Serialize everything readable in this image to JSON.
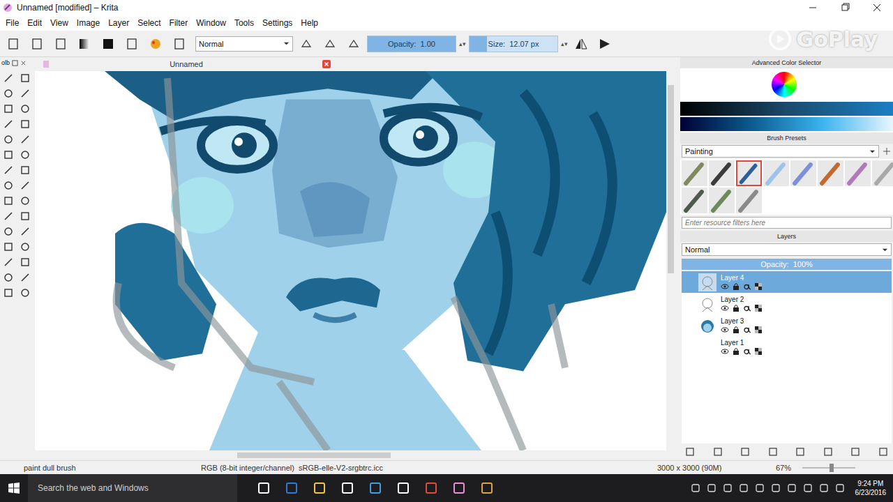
{
  "window": {
    "title": "Unnamed [modified] – Krita"
  },
  "watermark": {
    "text": "GoPlay"
  },
  "menu": [
    "File",
    "Edit",
    "View",
    "Image",
    "Layer",
    "Select",
    "Filter",
    "Window",
    "Tools",
    "Settings",
    "Help"
  ],
  "toolbar": {
    "blend_mode": "Normal",
    "opacity": {
      "text": "Opacity:  1.00",
      "level": 1
    },
    "size": {
      "text": "Size:  12.07 px",
      "level": 0.2
    }
  },
  "toolbox": {
    "title": "olb"
  },
  "document_tab": {
    "title": "Unnamed"
  },
  "color_selector": {
    "title": "Advanced Color Selector"
  },
  "brush_presets": {
    "title": "Brush Presets",
    "category": "Painting",
    "filter_placeholder": "Enter resource filters here",
    "presets": [
      {
        "selected": false,
        "color": "#7f8a5e"
      },
      {
        "selected": false,
        "color": "#3c3c3c"
      },
      {
        "selected": true,
        "color": "#2d5f9a"
      },
      {
        "selected": false,
        "color": "#9fc3e8"
      },
      {
        "selected": false,
        "color": "#7d8fd8"
      },
      {
        "selected": false,
        "color": "#c06a30"
      },
      {
        "selected": false,
        "color": "#b07ab8"
      },
      {
        "selected": false,
        "color": "#a9a9a9"
      },
      {
        "selected": false,
        "color": "#4f5a4f"
      },
      {
        "selected": false,
        "color": "#6e8a5a"
      },
      {
        "selected": false,
        "color": "#8a8a8a"
      }
    ]
  },
  "layers": {
    "title": "Layers",
    "blend_mode": "Normal",
    "opacity": {
      "text": "Opacity:  100%",
      "level": 1
    },
    "items": [
      {
        "name": "Layer 4",
        "selected": true,
        "kind": "sketch"
      },
      {
        "name": "Layer 2",
        "selected": false,
        "kind": "sketch"
      },
      {
        "name": "Layer 3",
        "selected": false,
        "kind": "painting"
      },
      {
        "name": "Layer 1",
        "selected": false,
        "kind": "blank"
      }
    ]
  },
  "status_bar": {
    "brush": "paint dull brush",
    "color_space": "RGB (8-bit integer/channel)  sRGB-elle-V2-srgbtrc.icc",
    "image_size": "3000 x 3000 (90M)",
    "zoom": "67%",
    "zoom_level": 0.55
  },
  "taskbar": {
    "search_placeholder": "Search the web and Windows",
    "time": "9:24 PM",
    "date": "6/23/2016"
  }
}
